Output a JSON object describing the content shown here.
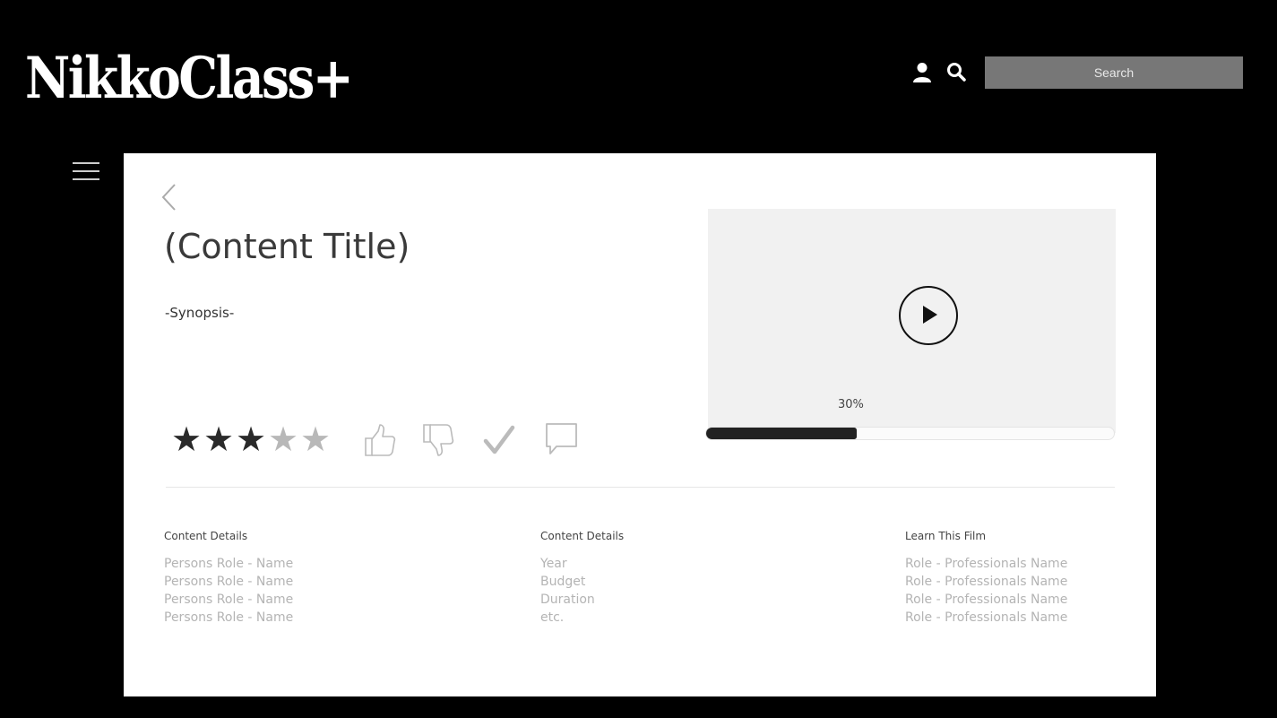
{
  "header": {
    "logo": "NikkoClass+",
    "search_placeholder": "Search"
  },
  "content": {
    "title": "(Content Title)",
    "synopsis": "-Synopsis-",
    "rating": {
      "value": 3,
      "max": 5
    },
    "progress": {
      "label": "30%",
      "percent": 37
    }
  },
  "columns": [
    {
      "heading": "Content Details",
      "items": [
        "Persons Role - Name",
        "Persons Role - Name",
        "Persons Role - Name",
        "Persons Role - Name"
      ]
    },
    {
      "heading": "Content Details",
      "items": [
        "Year",
        "Budget",
        "Duration",
        "etc."
      ]
    },
    {
      "heading": "Learn This Film",
      "items": [
        "Role - Professionals Name",
        "Role - Professionals Name",
        "Role - Professionals Name",
        "Role - Professionals Name"
      ]
    }
  ],
  "icons": [
    "user-icon",
    "search-icon",
    "menu-icon",
    "back-icon",
    "star-icon",
    "thumbs-up-icon",
    "thumbs-down-icon",
    "check-icon",
    "comment-icon",
    "play-icon"
  ],
  "colors": {
    "background": "#000000",
    "card": "#ffffff",
    "search_box": "#777777",
    "video_bg": "#f1f1f1",
    "progress_fill": "#222222"
  }
}
